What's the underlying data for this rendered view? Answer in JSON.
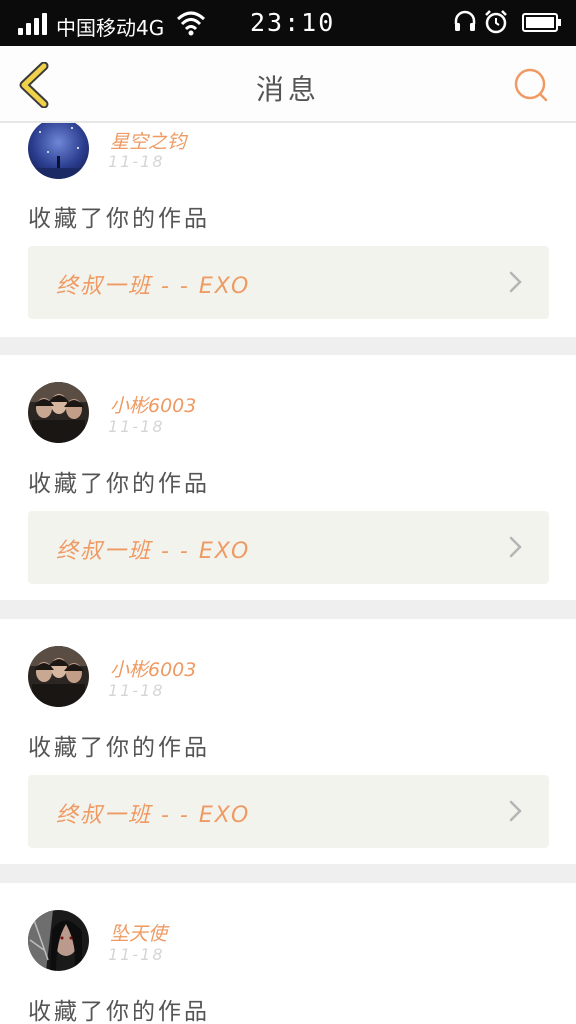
{
  "status_bar": {
    "carrier": "中国移动4G",
    "time": "23:10"
  },
  "nav": {
    "title": "消息",
    "back_icon": "chevron-left-icon",
    "search_icon": "search-icon"
  },
  "colors": {
    "accent": "#ef9a63",
    "back_icon": "#f0d14a",
    "work_box_bg": "#f3f3ee"
  },
  "messages": [
    {
      "username": "星空之钧",
      "date": "11-18",
      "action": "收藏了你的作品",
      "work_title": "终叔一班 - - EXO",
      "avatar": "starry-sky-avatar"
    },
    {
      "username": "小彬6003",
      "date": "11-18",
      "action": "收藏了你的作品",
      "work_title": "终叔一班 - - EXO",
      "avatar": "group-photo-avatar"
    },
    {
      "username": "小彬6003",
      "date": "11-18",
      "action": "收藏了你的作品",
      "work_title": "终叔一班 - - EXO",
      "avatar": "group-photo-avatar"
    },
    {
      "username": "坠天使",
      "date": "11-18",
      "action": "收藏了你的作品",
      "avatar": "dark-angel-avatar"
    }
  ]
}
